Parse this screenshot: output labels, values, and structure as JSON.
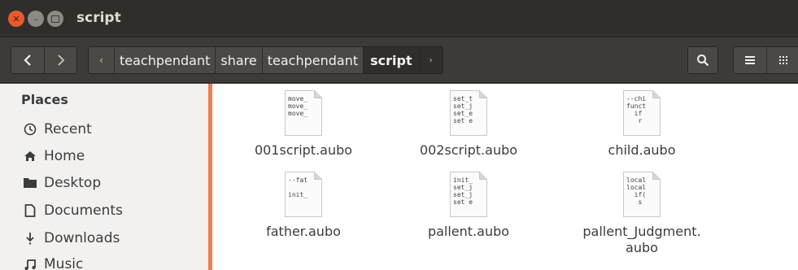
{
  "window": {
    "title": "script"
  },
  "toolbar": {
    "back_icon": "chevron-left-icon",
    "forward_icon": "chevron-right-icon",
    "breadcrumbs": [
      "teachpendant",
      "share",
      "teachpendant",
      "script"
    ],
    "search_icon": "search-icon",
    "list_view_icon": "list-view-icon",
    "grid_view_icon": "grid-view-icon"
  },
  "sidebar": {
    "title": "Places",
    "items": [
      {
        "label": "Recent",
        "icon": "clock-icon"
      },
      {
        "label": "Home",
        "icon": "home-icon"
      },
      {
        "label": "Desktop",
        "icon": "folder-icon"
      },
      {
        "label": "Documents",
        "icon": "document-icon"
      },
      {
        "label": "Downloads",
        "icon": "download-icon"
      },
      {
        "label": "Music",
        "icon": "music-icon"
      }
    ]
  },
  "files": [
    {
      "name": "001script.aubo",
      "preview": "move_\nmove_\nmove_"
    },
    {
      "name": "002script.aubo",
      "preview": "set_t\nset_j\nset_e\nset e"
    },
    {
      "name": "child.aubo",
      "preview": "--chi\nfunct\n  if\n   r"
    },
    {
      "name": "father.aubo",
      "preview": "--fat\n\ninit_"
    },
    {
      "name": "pallent.aubo",
      "preview": "init_\nset_j\nset_j\nset e"
    },
    {
      "name": "pallent_Judgment.\naubo",
      "preview": "local\nlocal\n  if(\n   s"
    }
  ],
  "colors": {
    "accent": "#ef7d52",
    "titlebar": "#2f2e2b",
    "toolbar": "#3c3b37",
    "sidebar": "#f2f1f0"
  }
}
